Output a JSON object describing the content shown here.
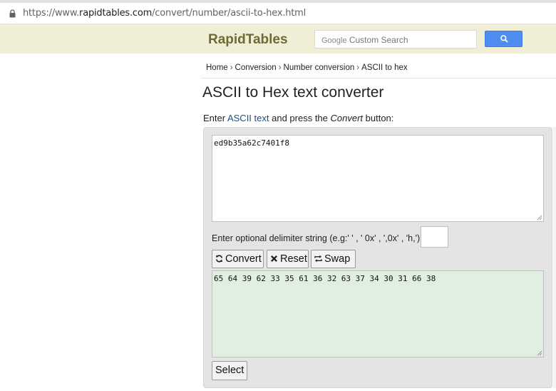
{
  "browser": {
    "url_scheme": "https://www.",
    "url_host": "rapidtables.com",
    "url_path": "/convert/number/ascii-to-hex.html"
  },
  "header": {
    "logo": "RapidTables",
    "search_google": "Google",
    "search_placeholder": "Custom Search"
  },
  "breadcrumb": [
    "Home",
    "Conversion",
    "Number conversion",
    "ASCII to hex"
  ],
  "page_title": "ASCII to Hex text converter",
  "intro": {
    "prefix": "Enter ",
    "link": "ASCII text",
    "middle": " and press the ",
    "emph": "Convert",
    "suffix": " button:"
  },
  "converter": {
    "input_value": "ed9b35a62c7401f8",
    "delimiter_label": "Enter optional delimiter string (e.g:' ' , ' 0x' , ',0x' , 'h,'):",
    "delimiter_value": "",
    "convert_label": "Convert",
    "reset_label": "Reset",
    "swap_label": "Swap",
    "output_value": "65 64 39 62 33 35 61 36 32 63 37 34 30 31 66 38",
    "select_label": "Select"
  },
  "icons": {
    "lock": "lock-icon",
    "search": "search-icon",
    "convert": "refresh-icon",
    "reset": "close-icon",
    "swap": "swap-icon"
  },
  "colors": {
    "header_bg": "#f1eed7",
    "logo": "#6b6b33",
    "search_button": "#4d8ef0",
    "link": "#1a4f8f",
    "output_bg": "#e0efe0",
    "panel_bg": "#e4e4e4"
  }
}
